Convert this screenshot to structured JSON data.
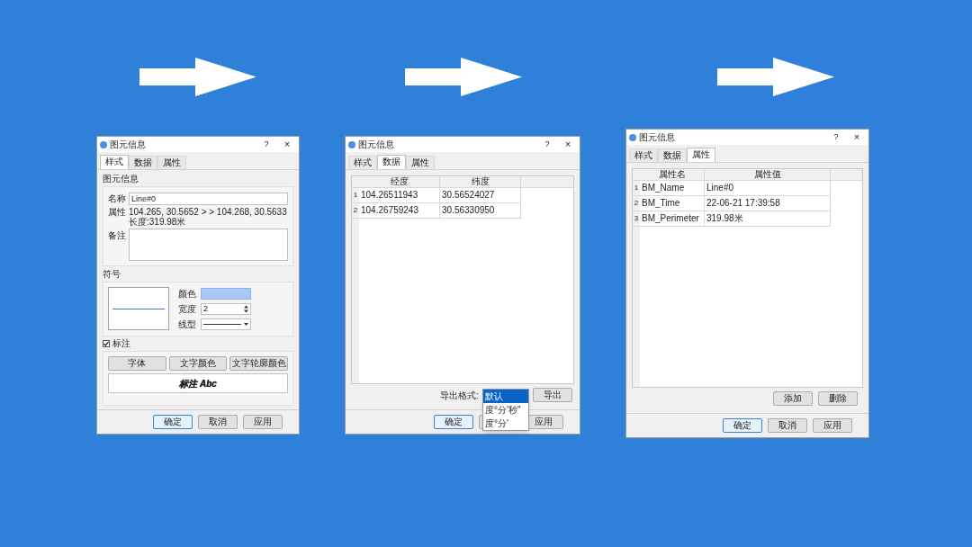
{
  "dialogs": [
    {
      "kind": "style",
      "title": "图元信息",
      "help": "?",
      "close": "×",
      "tabs": [
        {
          "label": "样式",
          "selected": true
        },
        {
          "label": "数据",
          "selected": false
        },
        {
          "label": "属性",
          "selected": false
        }
      ],
      "info_section": {
        "heading": "图元信息",
        "name_label": "名称",
        "name_value": "Line#0",
        "attr_label": "属性",
        "attr_lines": [
          "104.265, 30.5652 > > 104.268, 30.5633",
          "长度:319.98米"
        ],
        "note_label": "备注"
      },
      "symbol_section": {
        "heading": "符号",
        "color_label": "颜色",
        "width_label": "宽度",
        "width_value": "2",
        "line_type_label": "线型"
      },
      "label_section": {
        "checkbox_label": "标注",
        "checked": true,
        "buttons": [
          "字体",
          "文字颜色",
          "文字轮廓颜色"
        ],
        "preview": "标注 Abc"
      },
      "footer": [
        {
          "label": "确定",
          "default": true
        },
        {
          "label": "取消",
          "default": false
        },
        {
          "label": "应用",
          "default": false
        }
      ]
    },
    {
      "kind": "data",
      "title": "图元信息",
      "help": "?",
      "close": "×",
      "tabs": [
        {
          "label": "样式",
          "selected": false
        },
        {
          "label": "数据",
          "selected": true
        },
        {
          "label": "属性",
          "selected": false
        }
      ],
      "table": {
        "columns": [
          "经度",
          "纬度"
        ],
        "rows": [
          {
            "index": "1",
            "cells": [
              "104.26511943",
              "30.56524027"
            ]
          },
          {
            "index": "2",
            "cells": [
              "104.26759243",
              "30.56330950"
            ]
          }
        ]
      },
      "export_label": "导出格式:",
      "export_options": [
        {
          "label": "默认",
          "selected": true
        },
        {
          "label": "度°分'秒\"",
          "selected": false
        },
        {
          "label": "度°分'",
          "selected": false
        }
      ],
      "export_button": "导出",
      "footer": [
        {
          "label": "确定",
          "default": true
        },
        {
          "default": false
        },
        {
          "label": "应用",
          "default": false
        }
      ]
    },
    {
      "kind": "attributes",
      "title": "图元信息",
      "help": "?",
      "close": "×",
      "tabs": [
        {
          "label": "样式",
          "selected": false
        },
        {
          "label": "数据",
          "selected": false
        },
        {
          "label": "属性",
          "selected": true
        }
      ],
      "table": {
        "columns": [
          "属性名",
          "属性值"
        ],
        "rows": [
          {
            "index": "1",
            "cells": [
              "BM_Name",
              "Line#0"
            ]
          },
          {
            "index": "2",
            "cells": [
              "BM_Time",
              "22-06-21 17:39:58"
            ]
          },
          {
            "index": "3",
            "cells": [
              "BM_Perimeter",
              "319.98米"
            ]
          }
        ]
      },
      "buttons": [
        "添加",
        "删除"
      ],
      "footer": [
        {
          "label": "确定",
          "default": true
        },
        {
          "label": "取消",
          "default": false
        },
        {
          "label": "应用",
          "default": false
        }
      ]
    }
  ]
}
